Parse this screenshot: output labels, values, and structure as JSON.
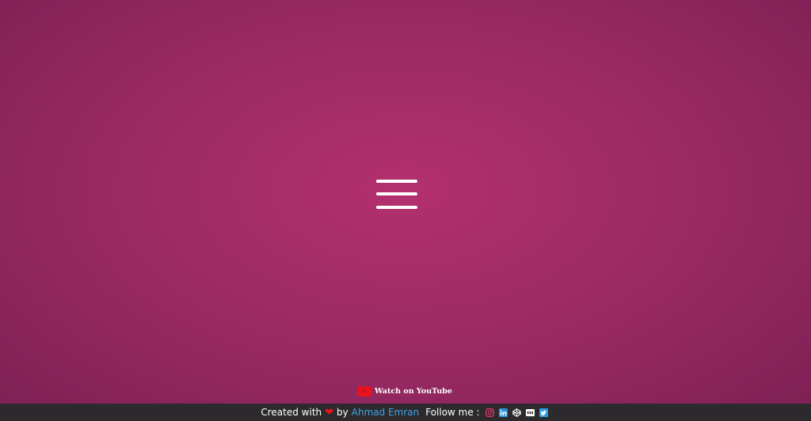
{
  "menu": {
    "icon": "hamburger-menu-icon"
  },
  "youtube": {
    "label": "Watch on YouTube",
    "icon": "youtube-icon",
    "icon_color": "#e8121b"
  },
  "footer": {
    "created_with": "Created with",
    "heart_icon": "heart-icon",
    "by": "by",
    "author": "Ahmad Emran",
    "follow_me": "Follow me :",
    "social_icons": [
      "instagram-icon",
      "linkedin-icon",
      "codepen-icon",
      "dev-icon",
      "twitter-icon"
    ],
    "link_color": "#3fa3e8",
    "background": "#2c2a2d"
  },
  "background": {
    "accent": "#b3306e",
    "edge": "#7d2055"
  }
}
